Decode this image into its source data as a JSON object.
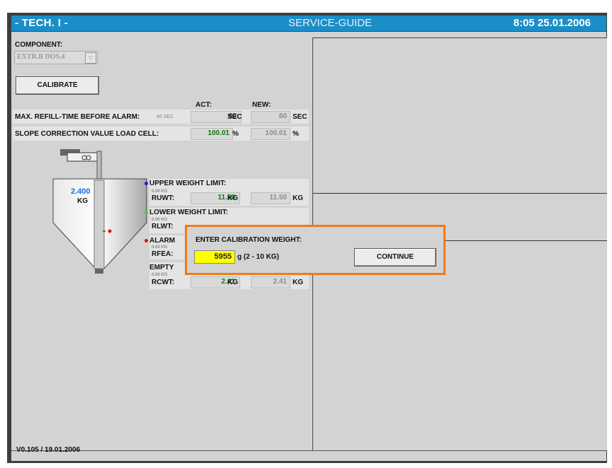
{
  "titlebar": {
    "left": "- TECH. I -",
    "center": "SERVICE-GUIDE",
    "right": "8:05  25.01.2006"
  },
  "component": {
    "label": "COMPONENT:",
    "value": "EXTR.B DOS.4"
  },
  "calibrate_button": "CALIBRATE",
  "columns": {
    "act": "ACT:",
    "new": "NEW:"
  },
  "max_refill": {
    "label": "MAX. REFILL-TIME BEFORE ALARM:",
    "hint": "60 SEC",
    "act": "60",
    "act_unit": "SEC",
    "new": "60",
    "new_unit": "SEC"
  },
  "slope": {
    "label": "SLOPE CORRECTION VALUE LOAD CELL:",
    "act": "100.01",
    "act_unit": "%",
    "new": "100.01",
    "new_unit": "%"
  },
  "hopper": {
    "weight": "2.400",
    "unit": "KG"
  },
  "upper": {
    "label": "UPPER WEIGHT LIMIT:",
    "hint": "0.00 KG",
    "code": "RUWT:",
    "act": "11.50",
    "act_unit": "KG",
    "new": "11.50",
    "new_unit": "KG"
  },
  "lower": {
    "label": "LOWER WEIGHT LIMIT:",
    "hint": "0.00 KG",
    "code": "RLWT:"
  },
  "alarm": {
    "label": "ALARM",
    "hint": "0.00 KG",
    "code": "RFEA:"
  },
  "empty": {
    "label": "EMPTY",
    "hint": "0.00 KG",
    "code": "RCWT:",
    "act": "2.41",
    "act_unit": "KG",
    "new": "2.41",
    "new_unit": "KG"
  },
  "dialog": {
    "title": "ENTER CALIBRATION WEIGHT:",
    "value": "5955",
    "unit": "g  (2 - 10 KG)",
    "continue": "CONTINUE"
  },
  "version": "V0.105 / 19.01.2006",
  "colors": {
    "title_bar": "#1b8ec8",
    "highlight": "#f07a1a",
    "input": "#ffff00",
    "act_value": "#0a7a0a",
    "weight": "#1a6ee0"
  }
}
